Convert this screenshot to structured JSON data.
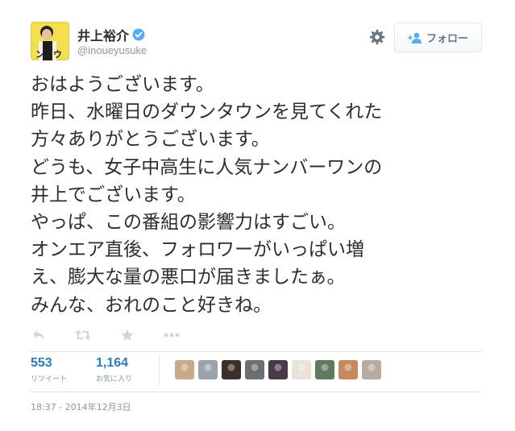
{
  "user": {
    "name": "井上裕介",
    "handle": "@inoueyusuke",
    "avatar_caption": "ンィウ"
  },
  "header": {
    "follow_label": "フォロー"
  },
  "tweet": {
    "lines": [
      "おはようございます。",
      "昨日、水曜日のダウンタウンを見てくれた",
      "方々ありがとうございます。",
      "どうも、女子中高生に人気ナンバーワンの",
      "井上でございます。",
      "やっぱ、この番組の影響力はすごい。",
      "オンエア直後、フォロワーがいっぱい増",
      "え、膨大な量の悪口が届きましたぁ。",
      "みんな、おれのこと好きね。"
    ]
  },
  "stats": {
    "retweets": {
      "count": "553",
      "label": "リツイート"
    },
    "favorites": {
      "count": "1,164",
      "label": "お気に入り"
    }
  },
  "favoriters": [
    {
      "name": "favoriter-1",
      "color": "#c9a98a"
    },
    {
      "name": "favoriter-2",
      "color": "#9aa3ab"
    },
    {
      "name": "favoriter-3",
      "color": "#3a2f2b"
    },
    {
      "name": "favoriter-4",
      "color": "#6e6e72"
    },
    {
      "name": "favoriter-5",
      "color": "#4a3a48"
    },
    {
      "name": "favoriter-6",
      "color": "#e8e2d8"
    },
    {
      "name": "favoriter-7",
      "color": "#5f7a5c"
    },
    {
      "name": "favoriter-8",
      "color": "#c48a5e"
    },
    {
      "name": "favoriter-9",
      "color": "#b7aba0"
    }
  ],
  "timestamp": "18:37 - 2014年12月3日",
  "colors": {
    "accent": "#2b7bb9",
    "verified": "#55acee",
    "muted": "#8899a6",
    "icon": "#ccd6dd"
  },
  "icons": [
    "verified-icon",
    "gear-icon",
    "add-user-icon",
    "reply-icon",
    "retweet-icon",
    "favorite-icon",
    "more-icon"
  ]
}
